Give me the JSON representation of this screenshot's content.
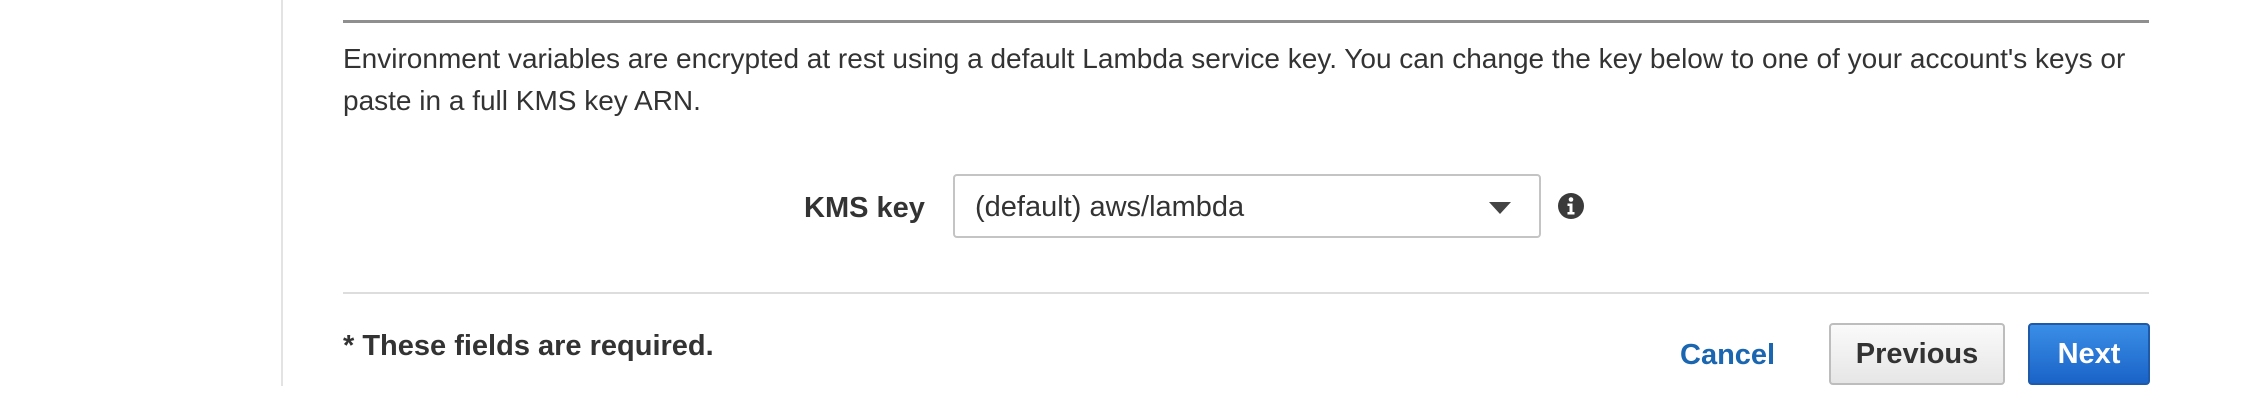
{
  "encryption": {
    "description": "Environment variables are encrypted at rest using a default Lambda service key. You can change the key below to one of your account's keys or paste in a full KMS key ARN.",
    "kms_label": "KMS key",
    "kms_selected": "(default) aws/lambda",
    "info_icon": "info-circle-icon"
  },
  "footer": {
    "required_note": "* These fields are required.",
    "cancel_label": "Cancel",
    "previous_label": "Previous",
    "next_label": "Next"
  },
  "colors": {
    "link": "#1a66b0",
    "primary_button": "#1a63c8",
    "text": "#333333"
  }
}
